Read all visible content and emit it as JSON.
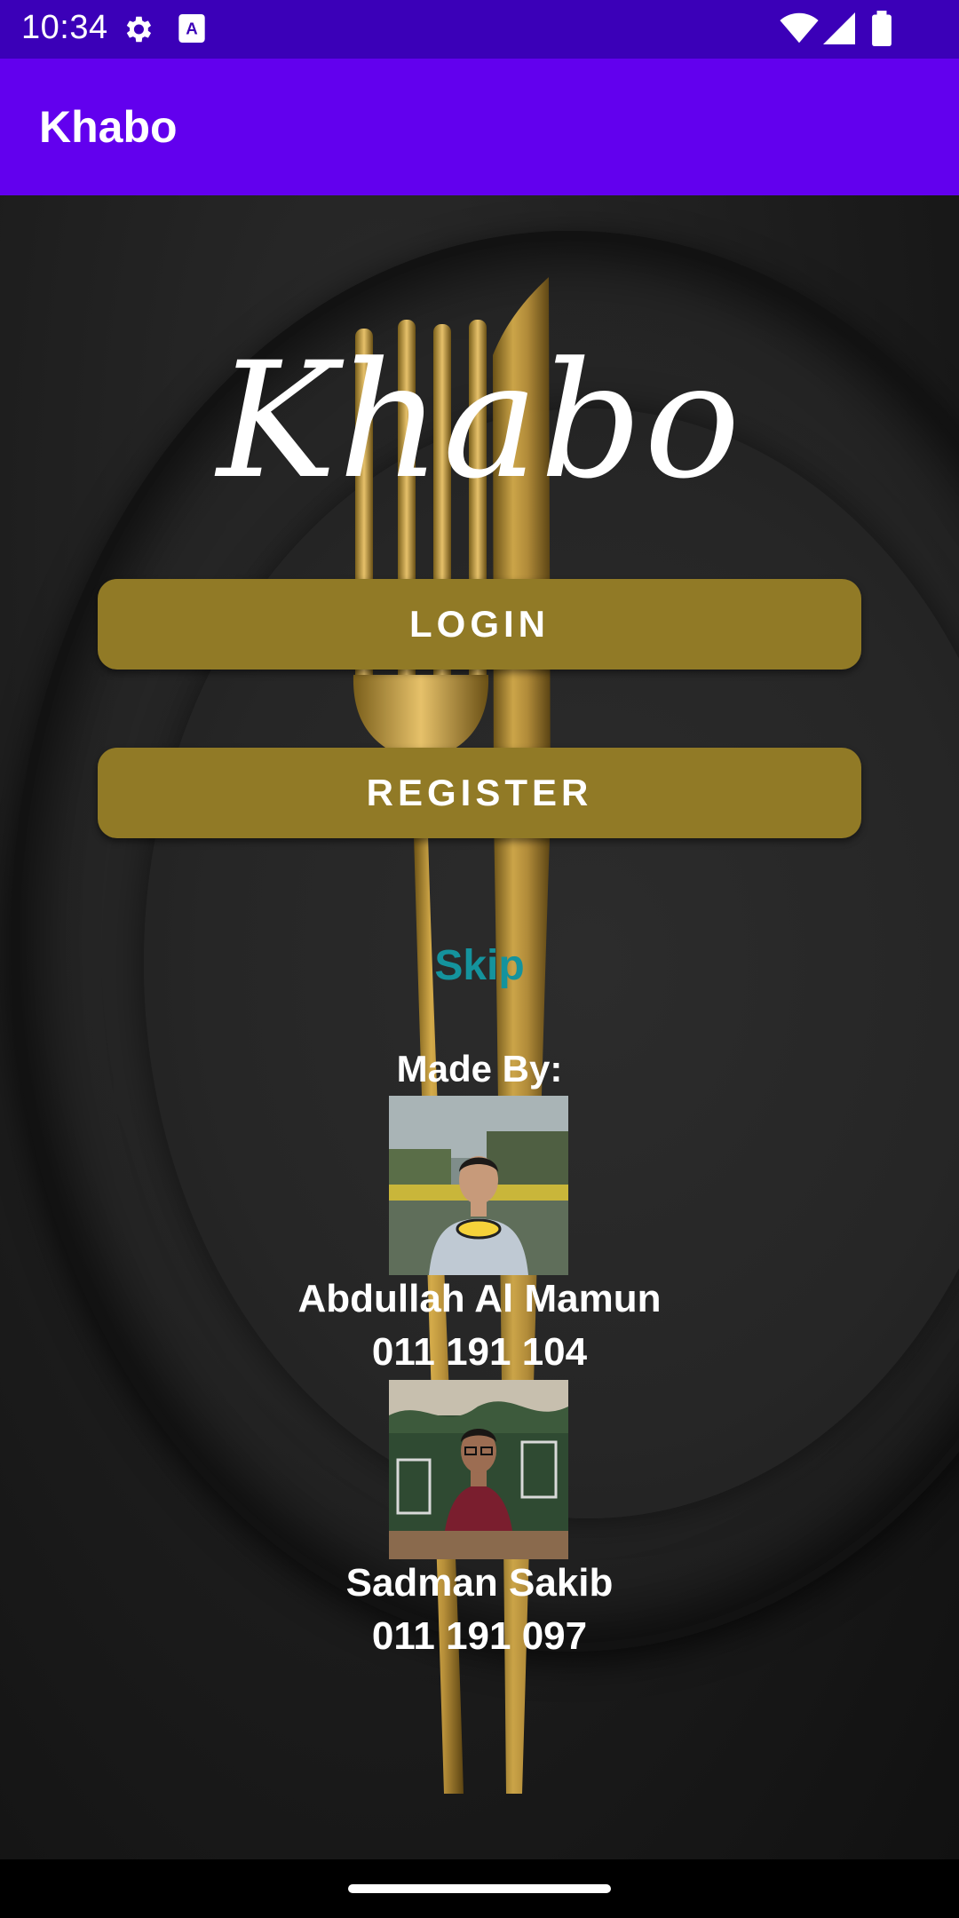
{
  "status_bar": {
    "time": "10:34",
    "icons": [
      "gear-icon",
      "font-icon",
      "wifi-icon",
      "signal-icon",
      "battery-icon"
    ]
  },
  "app_bar": {
    "title": "Khabo"
  },
  "main": {
    "brand_logo": "Khabo",
    "login_label": "LOGIN",
    "register_label": "REGISTER",
    "skip_label": "Skip",
    "made_by_label": "Made By:",
    "people": [
      {
        "name": "Abdullah Al Mamun",
        "id": "011 191 104"
      },
      {
        "name": "Sadman Sakib",
        "id": "011 191 097"
      }
    ]
  },
  "colors": {
    "status_bar": "#3b00b8",
    "app_bar": "#6200ee",
    "button": "#917a26",
    "skip_link": "#14939d"
  }
}
